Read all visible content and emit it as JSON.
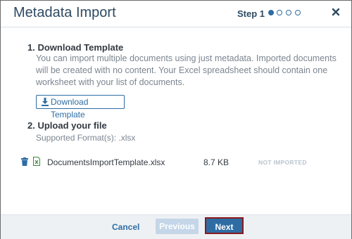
{
  "dialog": {
    "title": "Metadata Import",
    "step_label": "Step 1",
    "close_icon": "close-icon"
  },
  "step1": {
    "heading": "1. Download Template",
    "description": "You can import multiple documents using just metadata. Imported documents will be created with no content. Your Excel spreadsheet should contain one worksheet with your list of documents.",
    "download_button": "Download Template",
    "download_icon": "download-icon"
  },
  "step2": {
    "heading": "2. Upload your file",
    "supported": "Supported Format(s): .xlsx"
  },
  "file": {
    "name": "DocumentsImportTemplate.xlsx",
    "size": "8.7 KB",
    "status": "NOT IMPORTED",
    "delete_icon": "trash-icon",
    "type_icon": "excel-file-icon"
  },
  "footer": {
    "cancel": "Cancel",
    "previous": "Previous",
    "next": "Next"
  },
  "colors": {
    "accent": "#2e6da4",
    "title": "#2e4a63",
    "next_border": "#8b1a1a",
    "disabled_button": "#c4d6e8"
  }
}
